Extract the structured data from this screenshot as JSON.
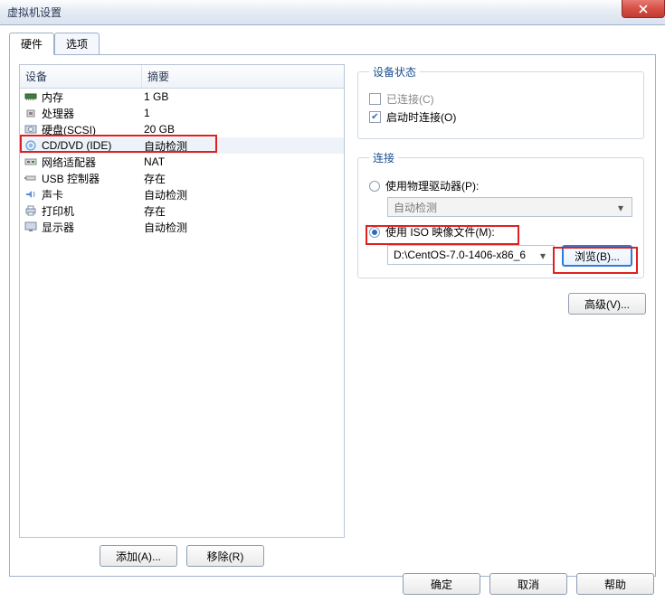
{
  "window": {
    "title": "虚拟机设置"
  },
  "tabs": {
    "hardware": "硬件",
    "options": "选项"
  },
  "hwTable": {
    "headDevice": "设备",
    "headSummary": "摘要",
    "rows": [
      {
        "name": "内存",
        "summary": "1 GB",
        "icon": "memory"
      },
      {
        "name": "处理器",
        "summary": "1",
        "icon": "cpu"
      },
      {
        "name": "硬盘(SCSI)",
        "summary": "20 GB",
        "icon": "hdd"
      },
      {
        "name": "CD/DVD (IDE)",
        "summary": "自动检测",
        "icon": "disc",
        "selected": true
      },
      {
        "name": "网络适配器",
        "summary": "NAT",
        "icon": "nic"
      },
      {
        "name": "USB 控制器",
        "summary": "存在",
        "icon": "usb"
      },
      {
        "name": "声卡",
        "summary": "自动检测",
        "icon": "sound"
      },
      {
        "name": "打印机",
        "summary": "存在",
        "icon": "printer"
      },
      {
        "name": "显示器",
        "summary": "自动检测",
        "icon": "display"
      }
    ]
  },
  "leftButtons": {
    "add": "添加(A)...",
    "remove": "移除(R)"
  },
  "status": {
    "legend": "设备状态",
    "connected": "已连接(C)",
    "connectOnStart": "启动时连接(O)"
  },
  "connection": {
    "legend": "连接",
    "usePhysical": "使用物理驱动器(P):",
    "physicalCombo": "自动检测",
    "useIso": "使用 ISO 映像文件(M):",
    "isoPath": "D:\\CentOS-7.0-1406-x86_6",
    "browse": "浏览(B)...",
    "advanced": "高级(V)..."
  },
  "dlg": {
    "ok": "确定",
    "cancel": "取消",
    "help": "帮助"
  }
}
